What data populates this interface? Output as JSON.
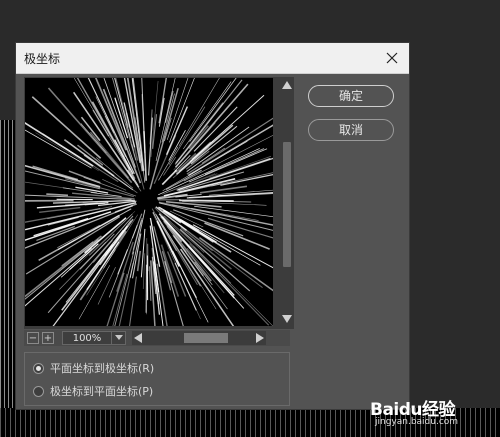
{
  "dialog": {
    "title": "极坐标",
    "ok_label": "确定",
    "cancel_label": "取消"
  },
  "zoom": {
    "value": "100%"
  },
  "options": [
    {
      "label": "平面坐标到极坐标(R)",
      "selected": true
    },
    {
      "label": "极坐标到平面坐标(P)",
      "selected": false
    }
  ],
  "watermark": {
    "logo": "Baidu经验",
    "url": "jingyan.baidu.com"
  },
  "icons": [
    "close-icon",
    "zoom-out-icon",
    "zoom-in-icon",
    "chevron-down-icon",
    "scroll-up-icon",
    "scroll-down-icon",
    "scroll-left-icon",
    "scroll-right-icon"
  ]
}
